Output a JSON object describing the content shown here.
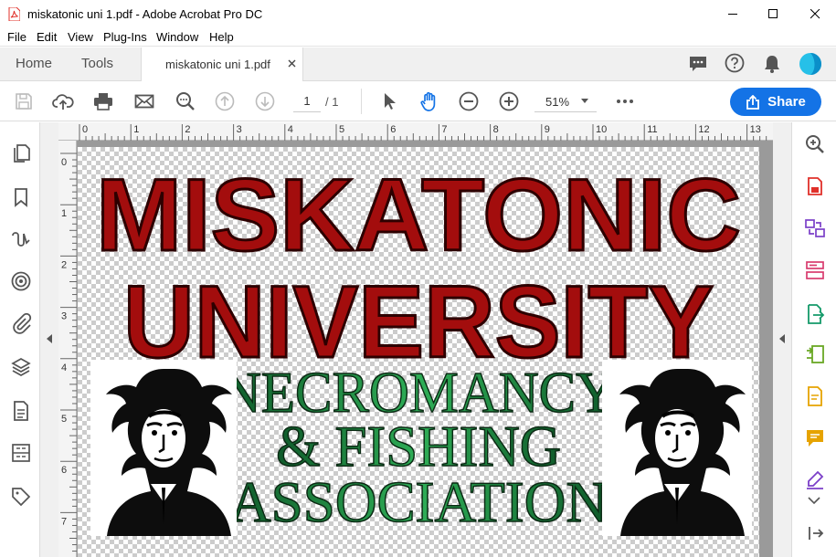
{
  "window": {
    "title": "miskatonic uni 1.pdf - Adobe Acrobat Pro DC"
  },
  "menu": [
    "File",
    "Edit",
    "View",
    "Plug-Ins",
    "Window",
    "Help"
  ],
  "tabs": {
    "home": "Home",
    "tools": "Tools",
    "document": "miskatonic uni 1.pdf"
  },
  "toolbar": {
    "page_current": "1",
    "page_total": "/ 1",
    "zoom": "51%",
    "share": "Share"
  },
  "ruler": {
    "top": [
      "0",
      "1",
      "2",
      "3",
      "4",
      "5",
      "6",
      "7",
      "8",
      "9",
      "10",
      "11",
      "12",
      "13"
    ],
    "left": [
      "0",
      "1",
      "2",
      "3",
      "4",
      "5",
      "6",
      "7"
    ]
  },
  "document": {
    "line1": "MISKATONIC",
    "line2": "UNIVERSITY",
    "line3": "NECROMANCY",
    "line4": "& FISHING",
    "line5": "ASSOCIATION"
  },
  "left_icons": [
    "pages-icon",
    "bookmark-icon",
    "signature-icon",
    "layers-target-icon",
    "attachment-icon",
    "layers-icon",
    "document-icon",
    "compare-icon",
    "tag-icon"
  ],
  "right_icons": [
    "zoom-search-icon",
    "export-pdf-icon",
    "combine-files-icon",
    "organize-pages-icon",
    "export-icon",
    "compress-icon",
    "edit-pdf-icon",
    "comment-icon",
    "fill-sign-icon"
  ],
  "colors": {
    "accent": "#1473e6",
    "title_red": "#a00d0d",
    "title_green": "#1f8a3e"
  }
}
